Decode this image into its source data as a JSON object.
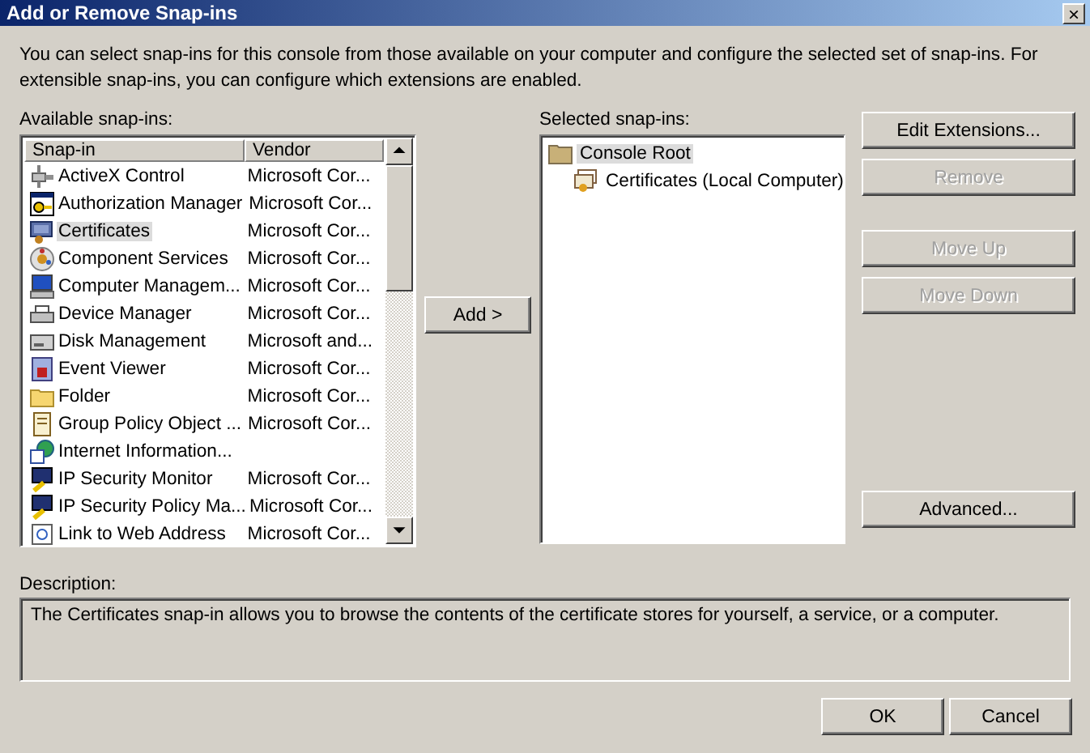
{
  "window": {
    "title": "Add or Remove Snap-ins",
    "close": "×"
  },
  "intro": "You can select snap-ins for this console from those available on your computer and configure the selected set of snap-ins. For extensible snap-ins, you can configure which extensions are enabled.",
  "available": {
    "label": "Available snap-ins:",
    "columns": [
      "Snap-in",
      "Vendor"
    ],
    "rows": [
      {
        "name": "ActiveX Control",
        "vendor": "Microsoft Cor...",
        "selected": false
      },
      {
        "name": "Authorization Manager",
        "vendor": "Microsoft Cor...",
        "selected": false
      },
      {
        "name": "Certificates",
        "vendor": "Microsoft Cor...",
        "selected": true
      },
      {
        "name": "Component Services",
        "vendor": "Microsoft Cor...",
        "selected": false
      },
      {
        "name": "Computer Managem...",
        "vendor": "Microsoft Cor...",
        "selected": false
      },
      {
        "name": "Device Manager",
        "vendor": "Microsoft Cor...",
        "selected": false
      },
      {
        "name": "Disk Management",
        "vendor": "Microsoft and...",
        "selected": false
      },
      {
        "name": "Event Viewer",
        "vendor": "Microsoft Cor...",
        "selected": false
      },
      {
        "name": "Folder",
        "vendor": "Microsoft Cor...",
        "selected": false
      },
      {
        "name": "Group Policy Object ...",
        "vendor": "Microsoft Cor...",
        "selected": false
      },
      {
        "name": "Internet Information...",
        "selected": false
      },
      {
        "name": "IP Security Monitor",
        "vendor": "Microsoft Cor...",
        "selected": false
      },
      {
        "name": "IP Security Policy Ma...",
        "vendor": "Microsoft Cor...",
        "selected": false
      },
      {
        "name": "Link to Web Address",
        "vendor": "Microsoft Cor...",
        "selected": false
      }
    ]
  },
  "add_button": {
    "label": "Add >",
    "disabled": false
  },
  "selected_snapins": {
    "label": "Selected snap-ins:",
    "tree": [
      {
        "label": "Console Root",
        "selected": true,
        "children": [
          {
            "label": "Certificates (Local Computer)",
            "selected": false
          }
        ]
      }
    ]
  },
  "side_buttons": [
    {
      "label": "Edit Extensions...",
      "disabled": false
    },
    {
      "label": "Remove",
      "disabled": true
    },
    {
      "label": "Move Up",
      "disabled": true
    },
    {
      "label": "Move Down",
      "disabled": true
    },
    {
      "label": "Advanced...",
      "disabled": false
    }
  ],
  "description": {
    "label": "Description:",
    "text": "The Certificates snap-in allows you to browse the contents of the certificate stores for yourself, a service, or a computer."
  },
  "footer_buttons": [
    {
      "label": "OK",
      "disabled": false
    },
    {
      "label": "Cancel",
      "disabled": false
    }
  ]
}
